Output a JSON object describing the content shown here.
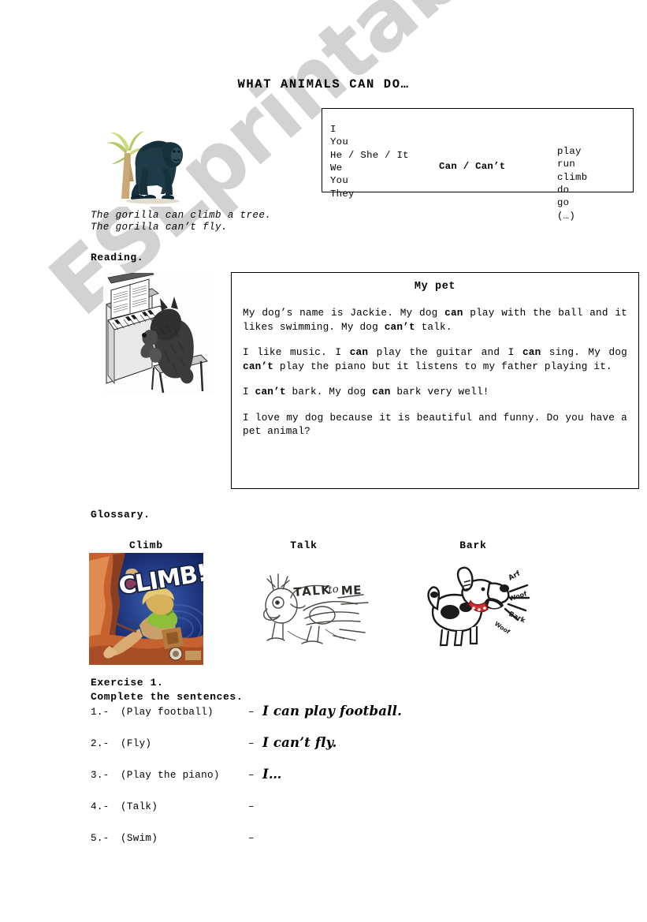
{
  "watermark": {
    "text": "ESLprintables.com",
    "color": "#d2d2d2"
  },
  "title": "WHAT  ANIMALS  CAN  DO…",
  "grammar_table": {
    "rows": [
      {
        "pronoun": "I",
        "modal": "",
        "verb": "play"
      },
      {
        "pronoun": "You",
        "modal": "",
        "verb": "run"
      },
      {
        "pronoun": "He / She / It",
        "modal": "Can / Can’t",
        "verb": "climb"
      },
      {
        "pronoun": "We",
        "modal": "",
        "verb": "do"
      },
      {
        "pronoun": "You",
        "modal": "",
        "verb": "go"
      },
      {
        "pronoun": "They",
        "modal": "",
        "verb": "(…)"
      }
    ]
  },
  "gorilla": {
    "image_name": "gorilla-illustration",
    "caption_line1": "The gorilla can climb a tree.",
    "caption_line2": "The gorilla can’t fly."
  },
  "reading": {
    "heading": "Reading.",
    "image_name": "dog-playing-piano-illustration",
    "title": "My pet",
    "paragraphs": [
      [
        {
          "t": "My dog’s name is Jackie. My dog ",
          "b": false
        },
        {
          "t": "can",
          "b": true
        },
        {
          "t": " play with the ball and it likes swimming. My dog ",
          "b": false
        },
        {
          "t": "can’t",
          "b": true
        },
        {
          "t": " talk.",
          "b": false
        }
      ],
      [
        {
          "t": "I like music. I ",
          "b": false
        },
        {
          "t": "can",
          "b": true
        },
        {
          "t": " play the guitar and I ",
          "b": false
        },
        {
          "t": "can",
          "b": true
        },
        {
          "t": " sing. My dog ",
          "b": false
        },
        {
          "t": "can’t",
          "b": true
        },
        {
          "t": " play the piano but it listens to my father playing it.",
          "b": false
        }
      ],
      [
        {
          "t": "I ",
          "b": false
        },
        {
          "t": "can’t",
          "b": true
        },
        {
          "t": " bark. My dog ",
          "b": false
        },
        {
          "t": "can",
          "b": true
        },
        {
          "t": " bark very well!",
          "b": false
        }
      ],
      [
        {
          "t": "I love my dog because it is beautiful and funny. Do you have a pet animal?",
          "b": false
        }
      ]
    ]
  },
  "glossary": {
    "heading": "Glossary.",
    "items": [
      {
        "label": "Climb",
        "image_name": "climb-comic-cover-illustration"
      },
      {
        "label": "Talk",
        "image_name": "talk-to-me-sketch-illustration"
      },
      {
        "label": "Bark",
        "image_name": "barking-dog-cartoon-illustration"
      }
    ],
    "climb_cover_text": "CLIMB!",
    "talk_sketch_text": "TALK to ME",
    "bark_sounds": [
      "Arf",
      "Woof",
      "Bark",
      "Woof"
    ]
  },
  "exercise": {
    "title": "Exercise 1.",
    "instruction": "Complete the sentences.",
    "items": [
      {
        "num": "1.-",
        "prompt": "(Play football)",
        "dash": "–",
        "answer": "I can play football."
      },
      {
        "num": "2.-",
        "prompt": "(Fly)",
        "dash": "–",
        "answer": "I can’t fly."
      },
      {
        "num": "3.-",
        "prompt": "(Play the piano)",
        "dash": "–",
        "answer": "I…"
      },
      {
        "num": "4.-",
        "prompt": "(Talk)",
        "dash": "–",
        "answer": ""
      },
      {
        "num": "5.-",
        "prompt": "(Swim)",
        "dash": "–",
        "answer": ""
      }
    ]
  }
}
